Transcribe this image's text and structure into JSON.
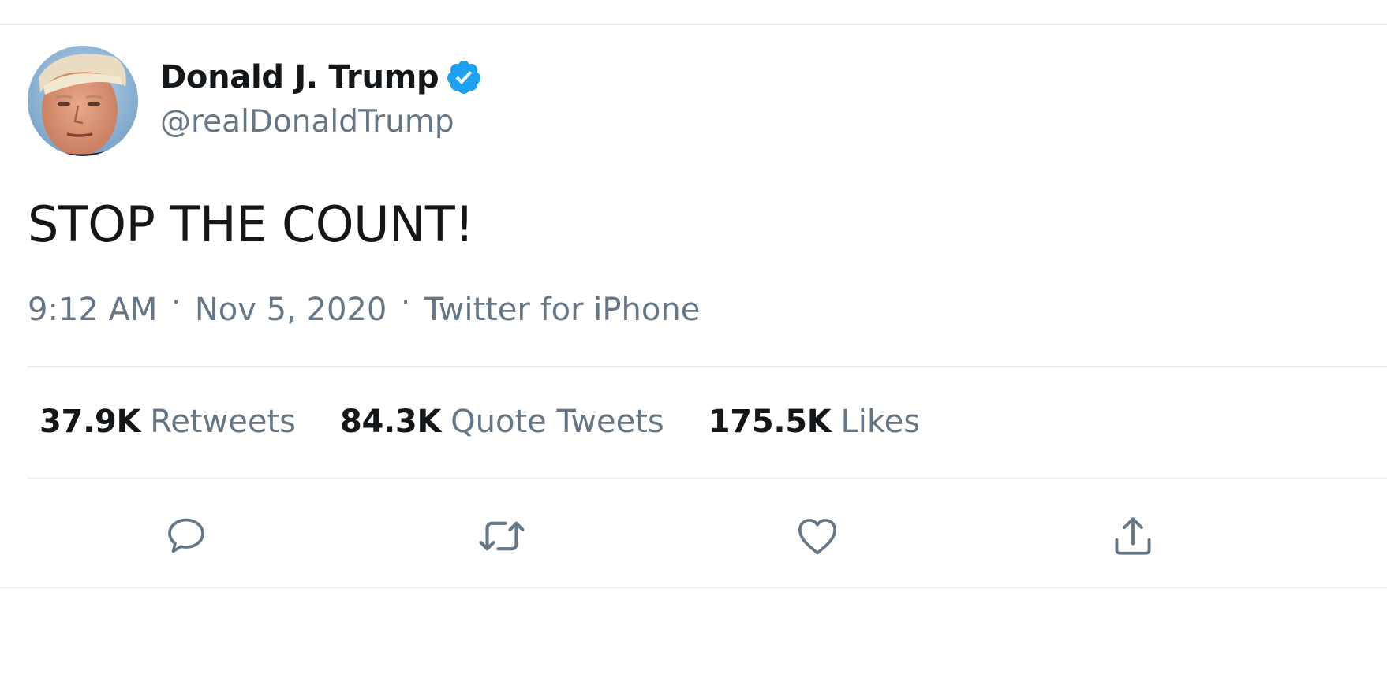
{
  "user": {
    "display_name": "Donald J. Trump",
    "handle": "@realDonaldTrump",
    "verified": true
  },
  "tweet": {
    "text": "STOP THE COUNT!",
    "time": "9:12 AM",
    "date": "Nov 5, 2020",
    "source": "Twitter for iPhone",
    "separator": "·"
  },
  "stats": {
    "retweets": {
      "count": "37.9K",
      "label": "Retweets"
    },
    "quote_tweets": {
      "count": "84.3K",
      "label": "Quote Tweets"
    },
    "likes": {
      "count": "175.5K",
      "label": "Likes"
    }
  },
  "actions": [
    "reply-icon",
    "retweet-icon",
    "like-icon",
    "share-icon"
  ],
  "colors": {
    "text_primary": "#14171a",
    "text_secondary": "#657786",
    "verified_blue": "#1da1f2",
    "icon_gray": "#657786",
    "divider": "#e6ecf0"
  }
}
